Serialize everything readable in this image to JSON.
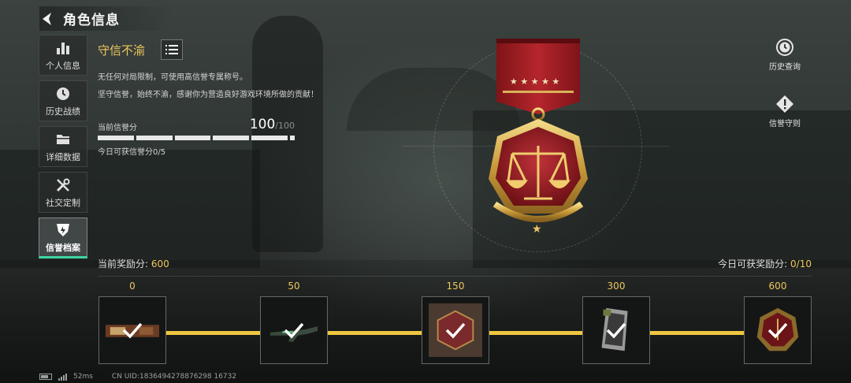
{
  "header": {
    "title": "角色信息"
  },
  "sidebar": {
    "items": [
      {
        "label": "个人信息",
        "icon": "bar-chart-icon"
      },
      {
        "label": "历史战绩",
        "icon": "clock-icon"
      },
      {
        "label": "详细数据",
        "icon": "folder-icon"
      },
      {
        "label": "社交定制",
        "icon": "tools-icon"
      },
      {
        "label": "信誉档案",
        "icon": "shield-icon",
        "active": true
      }
    ]
  },
  "reputation": {
    "title": "守信不渝",
    "desc1": "无任何对局限制，可使用高信誉专属称号。",
    "desc2": "坚守信誉，始终不渝，感谢你为营造良好游戏环境所做的贡献！",
    "score_label": "当前信誉分",
    "score": "100",
    "score_max": "/100",
    "score_fraction": 1.0,
    "today_label": "今日可获信誉分0/5"
  },
  "actions": {
    "history": "历史查询",
    "rules": "信誉守则"
  },
  "rewards": {
    "current_label": "当前奖励分:",
    "current_value": "600",
    "today_label": "今日可获奖励分:",
    "today_value": "0/10",
    "tiers": [
      {
        "value": "0",
        "claimed": true
      },
      {
        "value": "50",
        "claimed": true
      },
      {
        "value": "150",
        "claimed": true
      },
      {
        "value": "300",
        "claimed": true
      },
      {
        "value": "600",
        "claimed": true
      }
    ]
  },
  "footer": {
    "ping": "52ms",
    "uid": "CN UID:1836494278876298 16732"
  },
  "colors": {
    "accent_gold": "#f0c75e",
    "active_green": "#3ed6a0",
    "track": "#efc640"
  }
}
